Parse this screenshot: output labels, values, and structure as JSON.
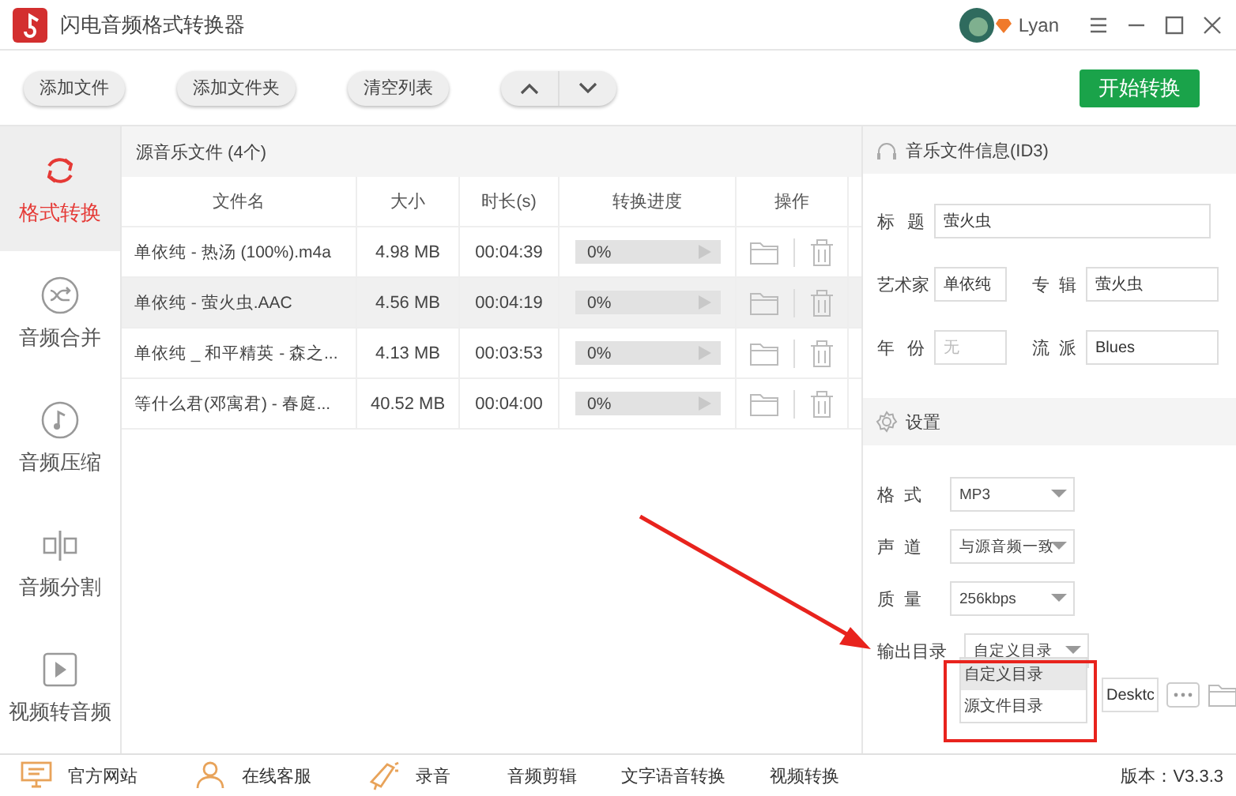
{
  "window": {
    "title": "闪电音频格式转换器",
    "user": "Lyan"
  },
  "toolbar": {
    "buttons": [
      "添加文件",
      "添加文件夹",
      "清空列表"
    ],
    "start_button": "开始转换"
  },
  "sidebar": {
    "items": [
      {
        "label": "格式转换",
        "kind": "convert",
        "selected": true
      },
      {
        "label": "音频合并",
        "kind": "merge",
        "selected": false
      },
      {
        "label": "音频压缩",
        "kind": "compress",
        "selected": false
      },
      {
        "label": "音频分割",
        "kind": "split",
        "selected": false
      },
      {
        "label": "视频转音频",
        "kind": "video",
        "selected": false
      }
    ]
  },
  "file_list": {
    "title": "源音乐文件 (4个)",
    "columns": [
      "文件名",
      "大小",
      "时长(s)",
      "转换进度",
      "操作"
    ],
    "rows": [
      {
        "name": "单依纯 - 热汤 (100%).m4a",
        "size": "4.98 MB",
        "duration": "00:04:39",
        "progress": "0%",
        "selected": false
      },
      {
        "name": "单依纯 - 萤火虫.AAC",
        "size": "4.56 MB",
        "duration": "00:04:19",
        "progress": "0%",
        "selected": true
      },
      {
        "name": "单依纯 _ 和平精英 - 森之...",
        "size": "4.13 MB",
        "duration": "00:03:53",
        "progress": "0%",
        "selected": false
      },
      {
        "name": "等什么君(邓寓君) - 春庭...",
        "size": "40.52 MB",
        "duration": "00:04:00",
        "progress": "0%",
        "selected": false
      }
    ]
  },
  "id3": {
    "title": "音乐文件信息(ID3)",
    "rows": [
      [
        {
          "label": "标 题",
          "value": "萤火虫"
        }
      ],
      [
        {
          "label": "艺术家",
          "value": "单依纯"
        },
        {
          "label": "专辑",
          "value": "萤火虫"
        }
      ],
      [
        {
          "label": "年 份",
          "placeholder": "无"
        },
        {
          "label": "流派",
          "value": "Blues"
        }
      ]
    ]
  },
  "settings": {
    "title": "设置",
    "fields": [
      {
        "label": "格 式",
        "value": "MP3"
      },
      {
        "label": "声 道",
        "value": "与源音频一致"
      },
      {
        "label": "质 量",
        "value": "256kbps"
      }
    ],
    "output_dir": {
      "label": "输出目录",
      "value": "自定义目录",
      "path": "Desktc",
      "options": [
        {
          "label": "自定义目录",
          "selected": true
        },
        {
          "label": "源文件目录",
          "selected": false
        }
      ]
    }
  },
  "status_bar": {
    "links": [
      {
        "label": "官方网站",
        "kind": "monitor"
      },
      {
        "label": "在线客服",
        "kind": "person"
      },
      {
        "label": "录音",
        "kind": "megaphone"
      },
      {
        "label": "音频剪辑",
        "kind": "none"
      },
      {
        "label": "文字语音转换",
        "kind": "none"
      },
      {
        "label": "视频转换",
        "kind": "none"
      }
    ],
    "version": "版本：V3.3.3"
  }
}
